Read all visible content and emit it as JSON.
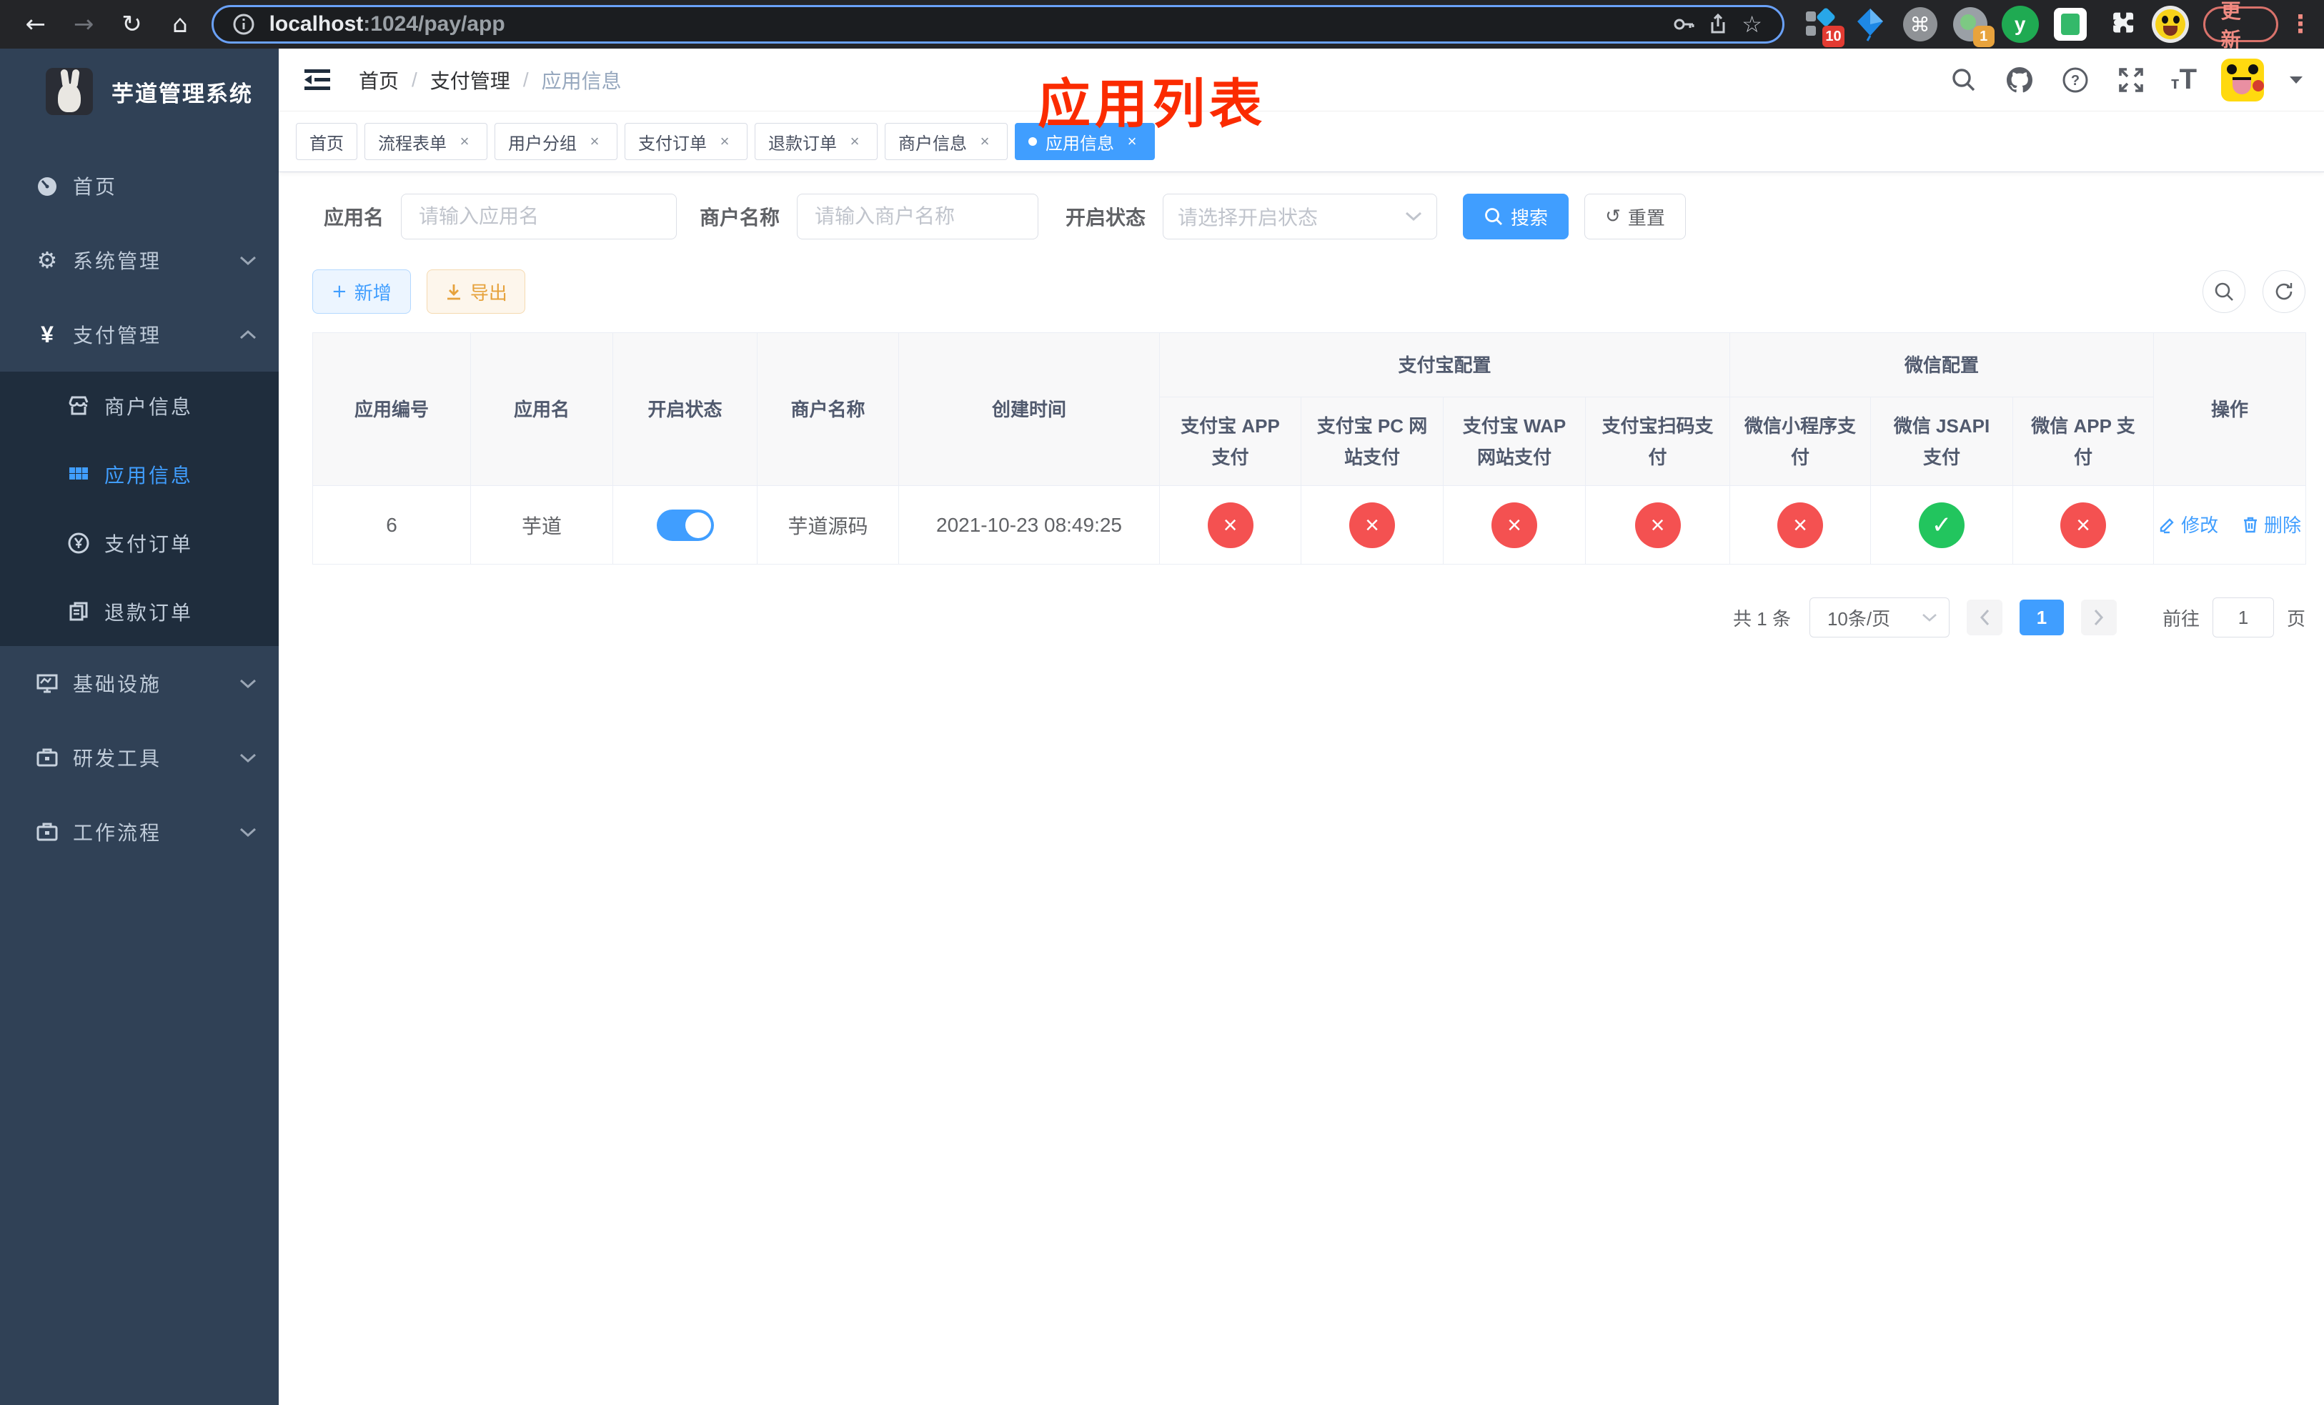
{
  "colors": {
    "accent": "#409eff",
    "danger": "#f45151",
    "success": "#22c55e",
    "title_red": "#fb2b00"
  },
  "browser": {
    "url": {
      "host": "localhost",
      "path": ":1024/pay/app"
    },
    "update_label": "更新",
    "ext_badge_10": "10",
    "ext_badge_1": "1",
    "ext_letter": "y"
  },
  "icons": {
    "back": "←",
    "forward": "→",
    "reload": "↻",
    "home": "⌂",
    "star": "☆",
    "command": "⌘",
    "more_dots": "⋮",
    "gear": "⚙",
    "yen": "¥",
    "plus": "+",
    "close": "×",
    "check": "✓",
    "cross": "×",
    "reset": "↺",
    "caret": "▾",
    "font_small": "т",
    "font_big": "T"
  },
  "sidebar": {
    "title": "芋道管理系统",
    "items": [
      {
        "label": "首页"
      },
      {
        "label": "系统管理"
      },
      {
        "label": "支付管理"
      },
      {
        "label": "商户信息"
      },
      {
        "label": "应用信息"
      },
      {
        "label": "支付订单"
      },
      {
        "label": "退款订单"
      },
      {
        "label": "基础设施"
      },
      {
        "label": "研发工具"
      },
      {
        "label": "工作流程"
      }
    ]
  },
  "header": {
    "breadcrumb": [
      "首页",
      "支付管理",
      "应用信息"
    ],
    "page_title": "应用列表"
  },
  "tabs": [
    {
      "label": "首页"
    },
    {
      "label": "流程表单"
    },
    {
      "label": "用户分组"
    },
    {
      "label": "支付订单"
    },
    {
      "label": "退款订单"
    },
    {
      "label": "商户信息"
    },
    {
      "label": "应用信息"
    }
  ],
  "filters": {
    "app_name_label": "应用名",
    "app_name_placeholder": "请输入应用名",
    "merchant_label": "商户名称",
    "merchant_placeholder": "请输入商户名称",
    "status_label": "开启状态",
    "status_placeholder": "请选择开启状态",
    "search_label": "搜索",
    "reset_label": "重置"
  },
  "toolbar": {
    "add_label": "新增",
    "export_label": "导出"
  },
  "table": {
    "columns": {
      "app_id": "应用编号",
      "app_name": "应用名",
      "status": "开启状态",
      "merchant": "商户名称",
      "created": "创建时间",
      "alipay_group": "支付宝配置",
      "alipay": [
        "支付宝 APP 支付",
        "支付宝 PC 网站支付",
        "支付宝 WAP 网站支付",
        "支付宝扫码支付"
      ],
      "wechat_group": "微信配置",
      "wechat": [
        "微信小程序支付",
        "微信 JSAPI 支付",
        "微信 APP 支付"
      ],
      "actions": "操作"
    },
    "rows": [
      {
        "app_id": "6",
        "app_name": "芋道",
        "status_on": true,
        "merchant": "芋道源码",
        "created": "2021-10-23 08:49:25",
        "channels": [
          false,
          false,
          false,
          false,
          false,
          true,
          false
        ],
        "edit_label": "修改",
        "delete_label": "删除"
      }
    ]
  },
  "pagination": {
    "total": "共 1 条",
    "page_size": "10条/页",
    "current_page": "1",
    "goto_label": "前往",
    "goto_value": "1",
    "page_unit": "页"
  }
}
